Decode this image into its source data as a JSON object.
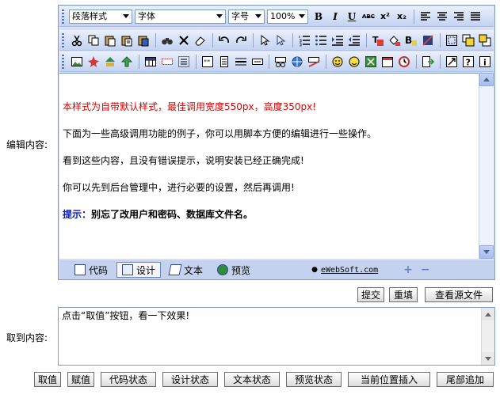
{
  "labels": {
    "edit_content": "编辑内容:",
    "get_content": "取到内容:"
  },
  "toolbar": {
    "paragraph_style": "段落样式",
    "font": "字体",
    "font_size": "字号",
    "zoom": "100%",
    "bold": "B",
    "italic": "I",
    "underline": "U",
    "strikethrough": "ABC",
    "superscript": "x²",
    "subscript": "x₂"
  },
  "editor": {
    "lines": [
      "本样式为自带默认样式，最佳调用宽度550px，高度350px!",
      "下面为一些高级调用功能的例子，你可以用脚本方便的编辑进行一些操作。",
      "看到这些内容，且没有错误提示，说明安装已经正确完成!",
      "你可以先到后台管理中，进行必要的设置，然后再调用!"
    ],
    "hint_label": "提示：",
    "hint_text": "别忘了改用户和密码、数据库文件名。"
  },
  "modes": {
    "code": "代码",
    "design": "设计",
    "text": "文本",
    "preview": "预览",
    "copyright": "eWebSoft.com",
    "plus": "+",
    "minus": "−"
  },
  "actions": {
    "submit": "提交",
    "reset": "重填",
    "view_source": "查看源文件"
  },
  "output": {
    "text": "点击“取值”按钮，看一下效果!"
  },
  "bottom_buttons": {
    "get_value": "取值",
    "set_value": "赋值",
    "code_state": "代码状态",
    "design_state": "设计状态",
    "text_state": "文本状态",
    "preview_state": "预览状态",
    "insert_at_cursor": "当前位置插入",
    "append_end": "尾部追加"
  },
  "colors": {
    "toolbar_bg": "#c3d3f2",
    "hint_blue": "#0018c6",
    "red_text": "#e00000"
  }
}
